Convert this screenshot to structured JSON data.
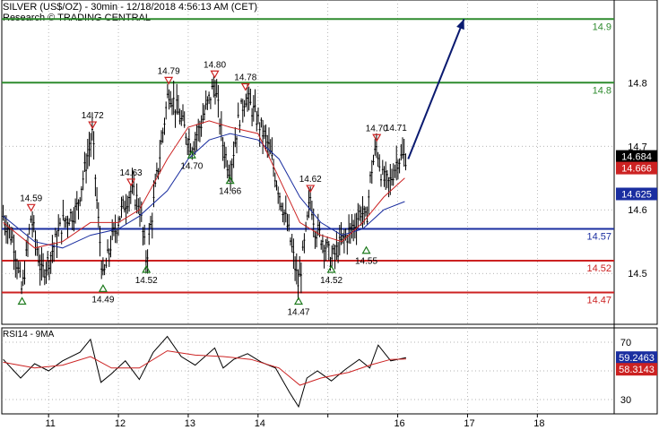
{
  "chart_data": [
    {
      "type": "line",
      "title": "SILVER (US$/OZ) - 30min - 12/18/2018 4:56:13 AM (CET)",
      "subtitle": "Research © TRADING CENTRAL",
      "ylim": [
        14.42,
        14.93
      ],
      "xlim": [
        10.33,
        19.1
      ],
      "x_ticks": [
        11,
        12,
        13,
        14,
        15,
        16,
        17,
        18
      ],
      "x_tick_labels": [
        "11",
        "12",
        "13",
        "14",
        "",
        "16",
        "17",
        "18"
      ],
      "y_ticks": [
        14.5,
        14.6,
        14.7,
        14.8
      ],
      "y_tick_labels": [
        "14.5",
        "14.6",
        "14.7",
        "14.8"
      ],
      "grid": true,
      "price": [
        [
          10.35,
          14.59
        ],
        [
          10.5,
          14.55
        ],
        [
          10.62,
          14.47
        ],
        [
          10.75,
          14.59
        ],
        [
          10.9,
          14.5
        ],
        [
          11.0,
          14.52
        ],
        [
          11.2,
          14.58
        ],
        [
          11.4,
          14.6
        ],
        [
          11.55,
          14.68
        ],
        [
          11.63,
          14.72
        ],
        [
          11.7,
          14.6
        ],
        [
          11.78,
          14.49
        ],
        [
          11.9,
          14.55
        ],
        [
          12.05,
          14.6
        ],
        [
          12.18,
          14.63
        ],
        [
          12.3,
          14.61
        ],
        [
          12.4,
          14.52
        ],
        [
          12.55,
          14.65
        ],
        [
          12.72,
          14.79
        ],
        [
          12.9,
          14.74
        ],
        [
          13.05,
          14.7
        ],
        [
          13.2,
          14.74
        ],
        [
          13.38,
          14.8
        ],
        [
          13.5,
          14.7
        ],
        [
          13.6,
          14.66
        ],
        [
          13.72,
          14.74
        ],
        [
          13.82,
          14.78
        ],
        [
          14.0,
          14.74
        ],
        [
          14.15,
          14.7
        ],
        [
          14.3,
          14.63
        ],
        [
          14.45,
          14.56
        ],
        [
          14.58,
          14.48
        ],
        [
          14.67,
          14.55
        ],
        [
          14.75,
          14.62
        ],
        [
          14.82,
          14.57
        ],
        [
          14.95,
          14.55
        ],
        [
          15.05,
          14.52
        ],
        [
          15.2,
          14.55
        ],
        [
          15.35,
          14.57
        ],
        [
          15.48,
          14.6
        ],
        [
          15.55,
          14.58
        ],
        [
          15.62,
          14.66
        ],
        [
          15.7,
          14.7
        ],
        [
          15.78,
          14.65
        ],
        [
          15.88,
          14.64
        ],
        [
          16.0,
          14.68
        ],
        [
          16.12,
          14.684
        ]
      ],
      "ma_fast": [
        [
          10.35,
          14.58
        ],
        [
          10.8,
          14.54
        ],
        [
          11.2,
          14.55
        ],
        [
          11.6,
          14.58
        ],
        [
          12.0,
          14.58
        ],
        [
          12.3,
          14.6
        ],
        [
          12.7,
          14.68
        ],
        [
          13.0,
          14.73
        ],
        [
          13.3,
          14.74
        ],
        [
          13.6,
          14.73
        ],
        [
          14.0,
          14.72
        ],
        [
          14.3,
          14.65
        ],
        [
          14.6,
          14.58
        ],
        [
          14.9,
          14.56
        ],
        [
          15.2,
          14.55
        ],
        [
          15.5,
          14.58
        ],
        [
          15.8,
          14.62
        ],
        [
          16.1,
          14.65
        ]
      ],
      "ma_slow": [
        [
          10.35,
          14.59
        ],
        [
          10.8,
          14.55
        ],
        [
          11.2,
          14.54
        ],
        [
          11.6,
          14.56
        ],
        [
          12.0,
          14.57
        ],
        [
          12.3,
          14.59
        ],
        [
          12.7,
          14.63
        ],
        [
          13.0,
          14.68
        ],
        [
          13.3,
          14.71
        ],
        [
          13.6,
          14.72
        ],
        [
          14.0,
          14.71
        ],
        [
          14.3,
          14.68
        ],
        [
          14.6,
          14.62
        ],
        [
          14.9,
          14.58
        ],
        [
          15.2,
          14.56
        ],
        [
          15.5,
          14.57
        ],
        [
          15.8,
          14.6
        ],
        [
          16.1,
          14.613
        ]
      ],
      "levels": [
        {
          "value": 14.9,
          "label": "14.9",
          "color": "#2e8b2e"
        },
        {
          "value": 14.8,
          "label": "14.8",
          "color": "#2e8b2e"
        },
        {
          "value": 14.57,
          "label": "14.57",
          "color": "#1a2ea0"
        },
        {
          "value": 14.52,
          "label": "14.52",
          "color": "#cc2222"
        },
        {
          "value": 14.47,
          "label": "14.47",
          "color": "#cc2222"
        }
      ],
      "price_tags": [
        {
          "value": 14.684,
          "label": "14.684",
          "bg": "#000000",
          "fg": "#ffffff"
        },
        {
          "value": 14.666,
          "label": "14.666",
          "bg": "#cc2222",
          "fg": "#ffffff"
        },
        {
          "value": 14.625,
          "label": "14.625",
          "bg": "#1a2ea0",
          "fg": "#ffffff"
        }
      ],
      "annotations": [
        {
          "x": 10.75,
          "y": 14.59,
          "label": "14.59",
          "kind": "high"
        },
        {
          "x": 11.63,
          "y": 14.72,
          "label": "14.72",
          "kind": "high"
        },
        {
          "x": 12.18,
          "y": 14.63,
          "label": "14.63",
          "kind": "high"
        },
        {
          "x": 12.72,
          "y": 14.79,
          "label": "14.79",
          "kind": "high"
        },
        {
          "x": 13.38,
          "y": 14.8,
          "label": "14.80",
          "kind": "high"
        },
        {
          "x": 13.82,
          "y": 14.78,
          "label": "14.78",
          "kind": "high"
        },
        {
          "x": 14.75,
          "y": 14.62,
          "label": "14.62",
          "kind": "high"
        },
        {
          "x": 15.7,
          "y": 14.7,
          "label": "14.70",
          "kind": "high"
        },
        {
          "x": 16.1,
          "y": 14.71,
          "label": "14.71",
          "kind": "text"
        },
        {
          "x": 10.62,
          "y": 14.47,
          "label": "",
          "kind": "low"
        },
        {
          "x": 11.78,
          "y": 14.49,
          "label": "14.49",
          "kind": "low"
        },
        {
          "x": 12.4,
          "y": 14.52,
          "label": "14.52",
          "kind": "low"
        },
        {
          "x": 13.05,
          "y": 14.7,
          "label": "14.70",
          "kind": "low"
        },
        {
          "x": 13.6,
          "y": 14.66,
          "label": "14.66",
          "kind": "low"
        },
        {
          "x": 14.58,
          "y": 14.47,
          "label": "14.47",
          "kind": "low"
        },
        {
          "x": 15.05,
          "y": 14.52,
          "label": "14.52",
          "kind": "low"
        },
        {
          "x": 15.55,
          "y": 14.55,
          "label": "14.55",
          "kind": "low"
        }
      ],
      "arrow": {
        "from": [
          16.15,
          14.68
        ],
        "to": [
          16.95,
          14.9
        ],
        "color": "#0a1a70"
      }
    },
    {
      "type": "line",
      "title": "RSI14 - 9MA",
      "ylim": [
        20,
        80
      ],
      "y_ticks": [
        30,
        50,
        70
      ],
      "y_tick_labels": [
        "30",
        "",
        "70"
      ],
      "grid": true,
      "rsi": [
        [
          10.35,
          58
        ],
        [
          10.6,
          45
        ],
        [
          10.8,
          55
        ],
        [
          11.0,
          50
        ],
        [
          11.2,
          57
        ],
        [
          11.45,
          63
        ],
        [
          11.6,
          72
        ],
        [
          11.75,
          42
        ],
        [
          11.9,
          48
        ],
        [
          12.1,
          57
        ],
        [
          12.3,
          44
        ],
        [
          12.5,
          63
        ],
        [
          12.7,
          74
        ],
        [
          12.9,
          60
        ],
        [
          13.1,
          54
        ],
        [
          13.38,
          66
        ],
        [
          13.5,
          52
        ],
        [
          13.65,
          58
        ],
        [
          13.85,
          62
        ],
        [
          14.05,
          56
        ],
        [
          14.25,
          52
        ],
        [
          14.45,
          35
        ],
        [
          14.58,
          25
        ],
        [
          14.7,
          45
        ],
        [
          14.85,
          50
        ],
        [
          15.05,
          43
        ],
        [
          15.25,
          51
        ],
        [
          15.45,
          58
        ],
        [
          15.6,
          52
        ],
        [
          15.72,
          68
        ],
        [
          15.9,
          57
        ],
        [
          16.12,
          59.2463
        ]
      ],
      "rsi_ma": [
        [
          10.35,
          56
        ],
        [
          10.8,
          52
        ],
        [
          11.2,
          54
        ],
        [
          11.6,
          60
        ],
        [
          11.9,
          52
        ],
        [
          12.3,
          52
        ],
        [
          12.7,
          64
        ],
        [
          13.1,
          61
        ],
        [
          13.5,
          60
        ],
        [
          13.9,
          58
        ],
        [
          14.3,
          52
        ],
        [
          14.6,
          40
        ],
        [
          14.9,
          45
        ],
        [
          15.3,
          49
        ],
        [
          15.6,
          54
        ],
        [
          15.9,
          58
        ],
        [
          16.12,
          58.3143
        ]
      ],
      "value_tags": [
        {
          "value": 59.2463,
          "label": "59.2463",
          "bg": "#1a2ea0",
          "fg": "#ffffff"
        },
        {
          "value": 58.3143,
          "label": "58.3143",
          "bg": "#cc2222",
          "fg": "#ffffff"
        }
      ]
    }
  ]
}
